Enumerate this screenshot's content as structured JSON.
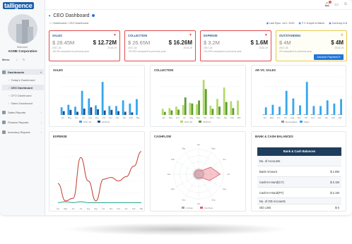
{
  "app": {
    "logo": "talligence"
  },
  "user": {
    "welcome": "Welcome,",
    "company": "ACME Corporation"
  },
  "menu": {
    "label": "Menu",
    "items": [
      {
        "label": "Dashboards",
        "type": "main",
        "active": true
      },
      {
        "label": "Today's Dashboard",
        "type": "sub"
      },
      {
        "label": "CEO Dashboard",
        "type": "sub",
        "active": true
      },
      {
        "label": "CFO Dashboard",
        "type": "sub"
      },
      {
        "label": "Sales Dashboard",
        "type": "sub"
      },
      {
        "label": "Sales Reports",
        "type": "main"
      },
      {
        "label": "Finance Reports",
        "type": "main"
      },
      {
        "label": "Inventory Reports",
        "type": "main"
      }
    ]
  },
  "header": {
    "notif_count": "1"
  },
  "page": {
    "title": "CEO Dashboard",
    "breadcrumb": "/ Dashboard / CEO Dashboard",
    "last_sync": "Last Sync: Jul 1, 2019",
    "fy": "F.Y. is April to March",
    "currency": "Currency in $"
  },
  "kpis": [
    {
      "title": "SALES",
      "current": "$ 28.45M",
      "prev": "$ 12.72M",
      "year_cur": "2017-18",
      "year_prev": "2018-19",
      "note": "-55.3% compared to previous year",
      "color": "#e04b4b"
    },
    {
      "title": "COLLECTION",
      "current": "$ 26.65M",
      "prev": "$ 16.26M",
      "year_cur": "2017-18",
      "year_prev": "2018-19",
      "note": "-39.03% compared to previous year",
      "color": "#e04b4b"
    },
    {
      "title": "EXPENSE",
      "current": "$ 3.2M",
      "prev": "$ 1.6M",
      "year_cur": "2017-18",
      "year_prev": "2018-19",
      "note": "-50.15% compared to previous year",
      "color": "#e04b4b"
    },
    {
      "title": "OUTSTANDING",
      "current": "$ 4M",
      "prev": "$ 4M",
      "year_cur": "2017-18",
      "year_prev": "2018-19",
      "note": "0% compared to previous year",
      "button": "Advance Payment",
      "color": "#e8c84a"
    }
  ],
  "chart_data": [
    {
      "type": "bar",
      "title": "SALES",
      "categories": [
        "Apr",
        "May",
        "Jun",
        "Jul",
        "Aug",
        "Sep",
        "Oct",
        "Nov",
        "Dec",
        "Jan",
        "Feb",
        "Mar"
      ],
      "series": [
        {
          "name": "2017-18",
          "color": "#35a6ec",
          "values": [
            1.2,
            1.6,
            1.3,
            3.8,
            2.6,
            1.5,
            5.2,
            1.4,
            1.4,
            2.3,
            1.8,
            2.5
          ]
        },
        {
          "name": "2018-19",
          "color": "#1f4f86",
          "values": [
            0.6,
            0.8,
            0.5,
            1.0,
            1.2,
            0.9,
            0.7,
            0.8,
            0.6,
            0.5,
            0.4,
            0
          ]
        }
      ],
      "ylim": [
        0,
        6
      ]
    },
    {
      "type": "bar",
      "title": "COLLECTION",
      "categories": [
        "Apr",
        "May",
        "Jun",
        "Jul",
        "Aug",
        "Sep",
        "Oct",
        "Nov",
        "Dec",
        "Jan",
        "Feb",
        "Mar"
      ],
      "series": [
        {
          "name": "2017-18",
          "color": "#b6d96b",
          "values": [
            0.8,
            0.9,
            1.1,
            1.3,
            1.6,
            1.4,
            4.6,
            1.2,
            2.1,
            3.6,
            1.8,
            1.9
          ]
        },
        {
          "name": "2018-19",
          "color": "#5b9e2f",
          "values": [
            0.4,
            0.6,
            0.7,
            2.3,
            1.5,
            1.9,
            3.4,
            0.8,
            1.1,
            1.7,
            0.9,
            0
          ]
        }
      ],
      "ylim": [
        0,
        5
      ]
    },
    {
      "type": "bar",
      "title": "AR VS. SALES",
      "categories": [
        "Apr",
        "May",
        "Jun",
        "Jul",
        "Aug",
        "Sep",
        "Oct",
        "Nov",
        "Dec",
        "Jan",
        "Feb",
        "Mar"
      ],
      "series": [
        {
          "name": "Receivables",
          "color": "#8a9aa8",
          "values": [
            0.1,
            0.1,
            0.1,
            0.1,
            0.1,
            0.1,
            0.1,
            0.1,
            0.1,
            0.1,
            0.1,
            0.1
          ]
        },
        {
          "name": "Sales",
          "color": "#35a6ec",
          "values": [
            1.2,
            1.6,
            1.3,
            3.8,
            2.6,
            1.5,
            5.2,
            1.4,
            1.4,
            2.3,
            1.8,
            2.5
          ]
        }
      ],
      "ylim": [
        0,
        6
      ]
    },
    {
      "type": "line",
      "title": "EXPENSE",
      "categories": [
        "Apr",
        "May",
        "Jun",
        "Jul",
        "Aug",
        "Sep",
        "Oct",
        "Nov",
        "Dec",
        "Jan",
        "Feb",
        "Mar"
      ],
      "series": [
        {
          "color": "#c0392b",
          "values": [
            0.25,
            0.05,
            0.08,
            0.55,
            0.28,
            0.05,
            0.3,
            0.32,
            0.28,
            0.33,
            0.45,
            0.62
          ]
        },
        {
          "color": "#16a085",
          "values": [
            0.03,
            0.04,
            0.03,
            0.04,
            0.03,
            0.03,
            0.03,
            0.03,
            0.03,
            0.03,
            0.03,
            0.03
          ]
        }
      ],
      "ylim": [
        0,
        0.7
      ]
    },
    {
      "type": "radar",
      "title": "CASHFLOW",
      "categories": [
        "Apr",
        "May",
        "Jun",
        "Jul",
        "Aug",
        "Sep",
        "Oct",
        "Nov",
        "Dec",
        "Jan",
        "Feb",
        "Mar"
      ],
      "series": [
        {
          "name": "In Flow",
          "color": "#9aa4ae",
          "values": [
            0.2,
            0.2,
            0.2,
            0.2,
            0.2,
            0.2,
            0.2,
            0.2,
            0.2,
            0.2,
            0.2,
            0.2
          ]
        },
        {
          "name": "Out Flow",
          "color": "#e35d6a",
          "values": [
            0.15,
            0.15,
            0.55,
            0.85,
            0.5,
            0.15,
            0.15,
            0.15,
            0.15,
            0.15,
            0.15,
            0.15
          ]
        }
      ]
    }
  ],
  "bank": {
    "title": "BANK & CASH BALANCES",
    "header": "Bank & Cash Balances",
    "rows": [
      {
        "label": "No. of Accounts",
        "value": ""
      },
      {
        "label": "Bank Amount",
        "value": "$ 1.8M"
      },
      {
        "label": "Cash-In-Hand(CY)",
        "value": "$ 2.1M"
      },
      {
        "label": "Cash-In-Hand(PY)",
        "value": "$ 2.1M"
      },
      {
        "label": "No. of OD Accounts",
        "value": ""
      },
      {
        "label": "OD Limit",
        "value": "$ 0"
      }
    ]
  }
}
